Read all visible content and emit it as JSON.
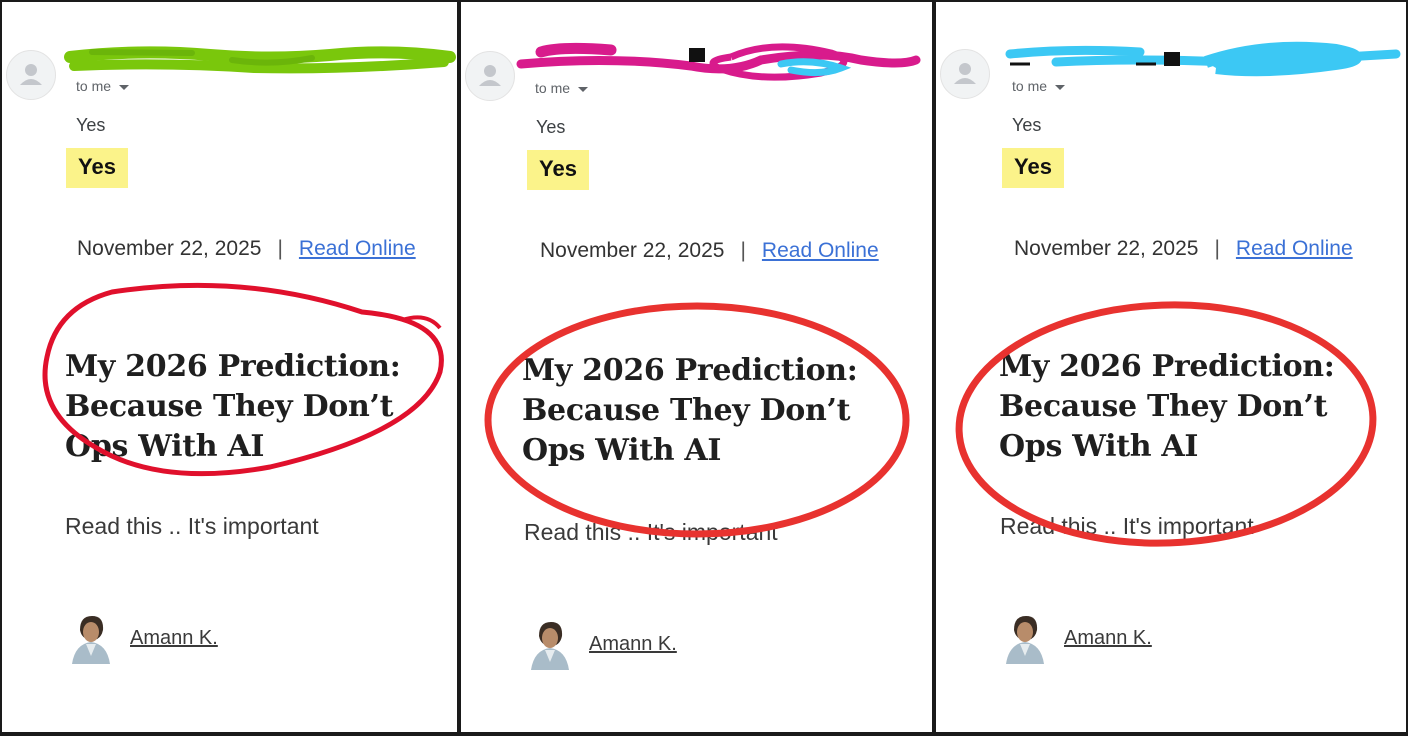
{
  "panels": [
    {
      "to_me": "to me",
      "reply_text": "Yes",
      "highlight_text": "Yes",
      "date": "November 22, 2025",
      "separator": "|",
      "read_online": "Read Online",
      "headline": [
        "My 2026 Prediction:",
        "Because They Don’t",
        "Ops With AI"
      ],
      "teaser": "Read this .. It's important",
      "author": "Amann K.",
      "redaction_color": "#7ac70c",
      "circle_color": "#e0102c"
    },
    {
      "to_me": "to me",
      "reply_text": "Yes",
      "highlight_text": "Yes",
      "date": "November 22, 2025",
      "separator": "|",
      "read_online": "Read Online",
      "headline": [
        "My 2026 Prediction:",
        "Because They Don’t",
        "Ops With AI"
      ],
      "teaser": "Read this .. It's important",
      "author": "Amann K.",
      "redaction_color": "#d81b8c",
      "circle_color": "#e8322f"
    },
    {
      "to_me": "to me",
      "reply_text": "Yes",
      "highlight_text": "Yes",
      "date": "November 22, 2025",
      "separator": "|",
      "read_online": "Read Online",
      "headline": [
        "My 2026 Prediction:",
        "Because They Don’t",
        "Ops With AI"
      ],
      "teaser": "Read this .. It's important",
      "author": "Amann K.",
      "redaction_color": "#3cc8f4",
      "circle_color": "#e8322f"
    }
  ],
  "icons": {
    "avatar": "person-avatar-icon",
    "dropdown": "chevron-down-icon",
    "author_photo": "author-photo"
  }
}
